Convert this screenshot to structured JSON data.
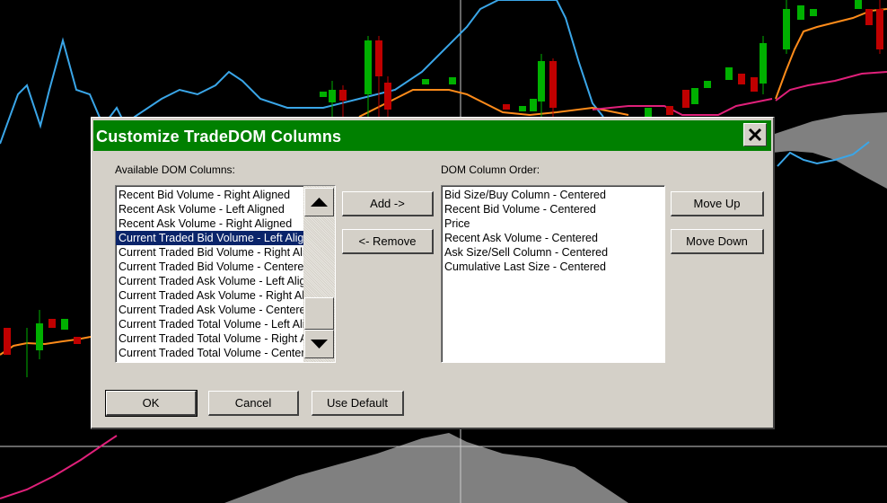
{
  "dialog": {
    "title": "Customize TradeDOM Columns",
    "close_label": "✕",
    "available_label": "Available DOM Columns:",
    "order_label": "DOM Column Order:",
    "available_columns": [
      "Recent Bid Volume - Right Aligned",
      "Recent Ask Volume - Left Aligned",
      "Recent Ask Volume - Right Aligned",
      "Current Traded Bid Volume - Left Aligned",
      "Current Traded Bid Volume - Right Aligned",
      "Current Traded Bid Volume - Centered",
      "Current Traded Ask Volume - Left Aligned",
      "Current Traded Ask Volume - Right Aligned",
      "Current Traded Ask Volume - Centered",
      "Current Traded Total Volume - Left Aligned",
      "Current Traded Total Volume - Right Aligned",
      "Current Traded Total Volume - Centered"
    ],
    "selected_available_index": 3,
    "column_order": [
      "Bid Size/Buy Column - Centered",
      "Recent Bid Volume - Centered",
      "Price",
      "Recent Ask Volume - Centered",
      "Ask Size/Sell Column - Centered",
      "Cumulative Last Size - Centered"
    ],
    "buttons": {
      "add": "Add ->",
      "remove": "<- Remove",
      "move_up": "Move Up",
      "move_down": "Move Down",
      "ok": "OK",
      "cancel": "Cancel",
      "use_default": "Use Default"
    }
  },
  "colors": {
    "titlebar": "#008000",
    "selection": "#0a246a",
    "chart_blue": "#3aa6e8",
    "chart_orange": "#ff8c1a",
    "chart_magenta": "#e0207a",
    "cloud": "#808080"
  }
}
